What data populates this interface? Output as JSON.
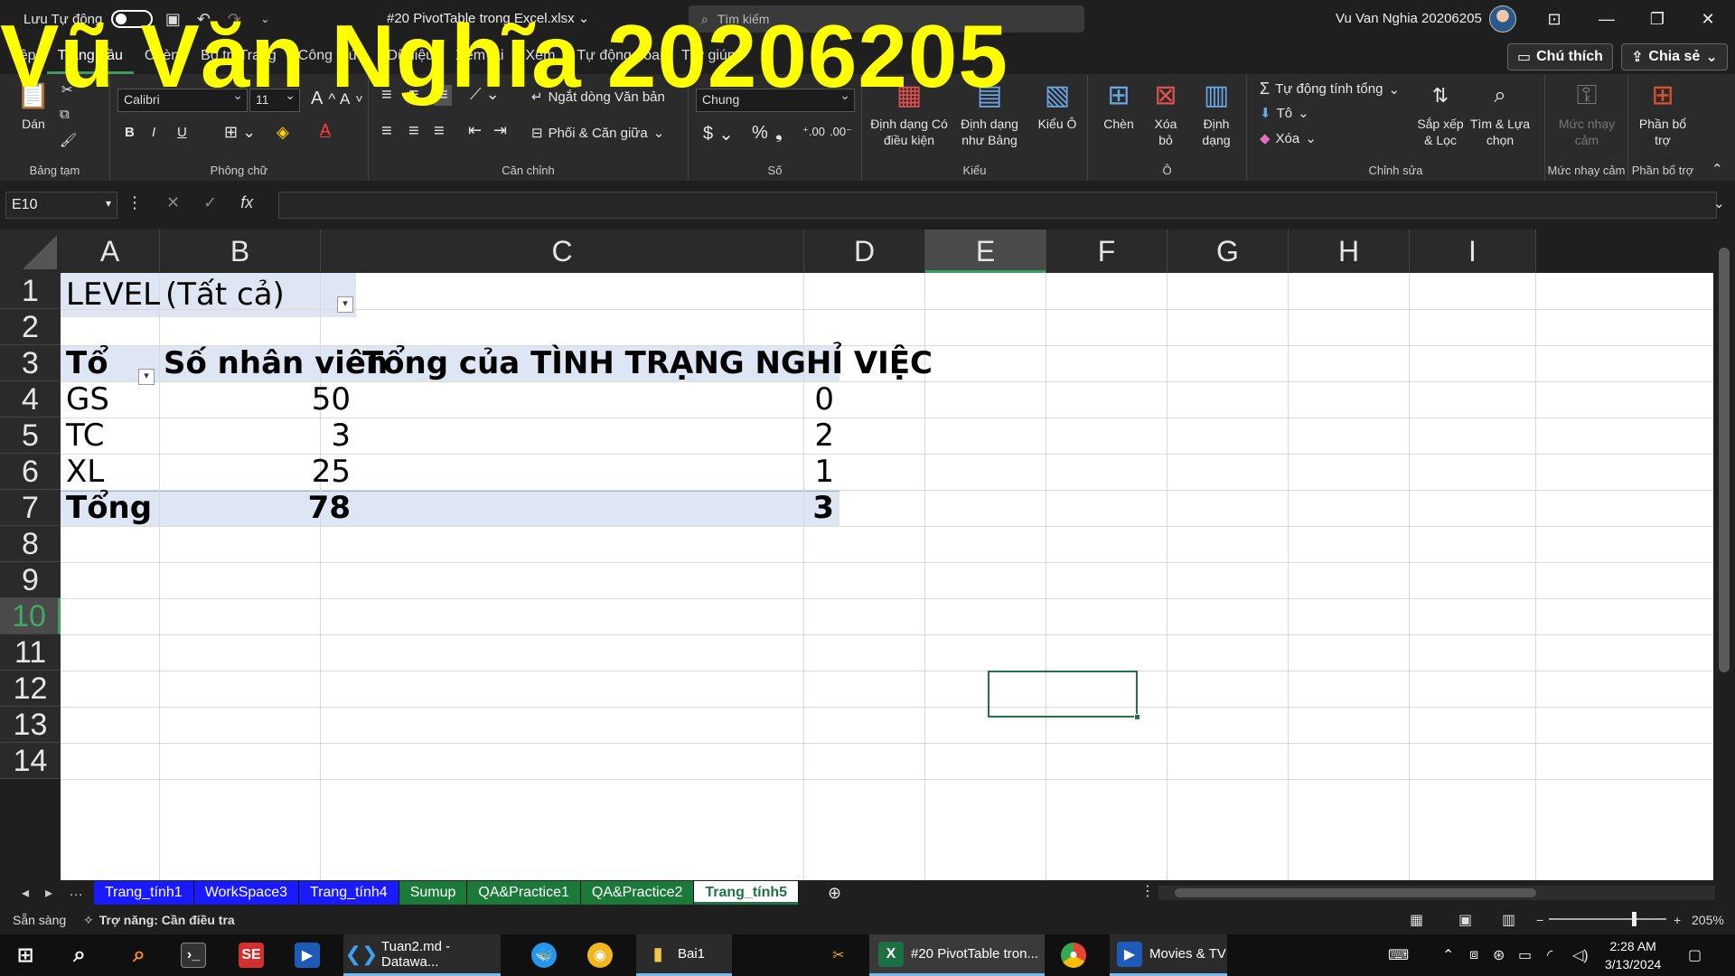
{
  "titlebar": {
    "autosave_label": "Lưu Tự động",
    "doc_title": "#20 PivotTable trong Excel.xlsx",
    "search_placeholder": "Tìm kiếm",
    "user_name": "Vu Van Nghia 20206205"
  },
  "watermark": "Vũ Văn Nghĩa 20206205",
  "ribbon_tabs": [
    "Tệp",
    "Trang đầu",
    "Chèn",
    "Bố trí Trang",
    "Công thức",
    "Dữ liệu",
    "Xem lại",
    "Xem",
    "Tự động hóa",
    "Trợ giúp"
  ],
  "active_tab": "Trang đầu",
  "tab_buttons": {
    "comment": "Chú thích",
    "share": "Chia sẻ"
  },
  "ribbon": {
    "clipboard": {
      "paste": "Dán",
      "label": "Bảng tạm"
    },
    "font": {
      "name": "Calibri",
      "size": "11",
      "label": "Phông chữ",
      "bold": "B",
      "italic": "I",
      "underline": "U"
    },
    "alignment": {
      "wrap": "Ngắt dòng Văn bản",
      "merge": "Phối & Căn giữa",
      "label": "Căn chỉnh"
    },
    "number": {
      "format": "Chung",
      "label": "Số",
      "currency": "$",
      "percent": "%"
    },
    "styles": {
      "conditional": "Định dạng Có điều kiện",
      "as_table": "Định dạng như Bảng",
      "cell_styles": "Kiểu Ô",
      "label": "Kiểu"
    },
    "cells": {
      "insert": "Chèn",
      "delete": "Xóa bỏ",
      "format": "Định dạng",
      "label": "Ô"
    },
    "editing": {
      "autosum": "Tự động tính tổng",
      "fill": "Tô",
      "clear": "Xóa",
      "sort": "Sắp xếp & Lọc",
      "find": "Tìm & Lựa chọn",
      "label": "Chỉnh sửa"
    },
    "sensitivity": {
      "btn": "Mức nhạy cảm",
      "label": "Mức nhạy cảm"
    },
    "addins": {
      "btn": "Phần bổ trợ",
      "label": "Phần bổ trợ"
    }
  },
  "formula_bar": {
    "name_box": "E10",
    "fx": "fx",
    "content": ""
  },
  "columns": [
    "A",
    "B",
    "C",
    "D",
    "E",
    "F",
    "G",
    "H",
    "I"
  ],
  "selected_column": "E",
  "rows": [
    "1",
    "2",
    "3",
    "4",
    "5",
    "6",
    "7",
    "8",
    "9",
    "10",
    "11",
    "12",
    "13",
    "14"
  ],
  "selected_row": "10",
  "pivot": {
    "filter_field": "LEVEL",
    "filter_value": "(Tất cả)",
    "headers": [
      "Tổ",
      "Số nhân viên",
      "Tổng của TÌNH TRẠNG NGHỈ VIỆC"
    ],
    "rows": [
      {
        "group": "GS",
        "count": "50",
        "sum": "0"
      },
      {
        "group": "TC",
        "count": "3",
        "sum": "2"
      },
      {
        "group": "XL",
        "count": "25",
        "sum": "1"
      }
    ],
    "total": {
      "label": "Tổng",
      "count": "78",
      "sum": "3"
    }
  },
  "sheet_tabs": [
    {
      "name": "Trang_tính1",
      "color": "#1a1aff"
    },
    {
      "name": "WorkSpace3",
      "color": "#1a1aff"
    },
    {
      "name": "Trang_tính4",
      "color": "#1a1aff"
    },
    {
      "name": "Sumup",
      "color": "#1b7a3a"
    },
    {
      "name": "QA&Practice1",
      "color": "#1b7a3a"
    },
    {
      "name": "QA&Practice2",
      "color": "#1b7a3a"
    },
    {
      "name": "Trang_tính5",
      "color": "#ffffff"
    }
  ],
  "active_sheet": "Trang_tính5",
  "status": {
    "ready": "Sẵn sàng",
    "accessibility": "Trợ năng: Cần điều tra",
    "zoom": "205%"
  },
  "taskbar": {
    "items": [
      "Tuan2.md - Datawa...",
      "Bai1",
      "#20 PivotTable tron...",
      "Movies & TV"
    ],
    "time": "2:28 AM",
    "date": "3/13/2024"
  }
}
